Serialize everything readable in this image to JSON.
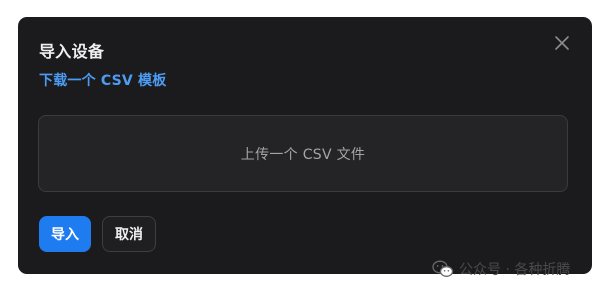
{
  "dialog": {
    "title": "导入设备",
    "template_link": "下载一个 CSV 模板",
    "upload_prompt": "上传一个 CSV 文件",
    "import_label": "导入",
    "cancel_label": "取消",
    "close_icon": "close-icon"
  },
  "watermark": {
    "text": "公众号 · 各种折腾",
    "icon": "wechat-icon"
  },
  "colors": {
    "dialog_bg": "#1b1b1d",
    "accent": "#1f7cf0",
    "link": "#4d9cf3"
  }
}
